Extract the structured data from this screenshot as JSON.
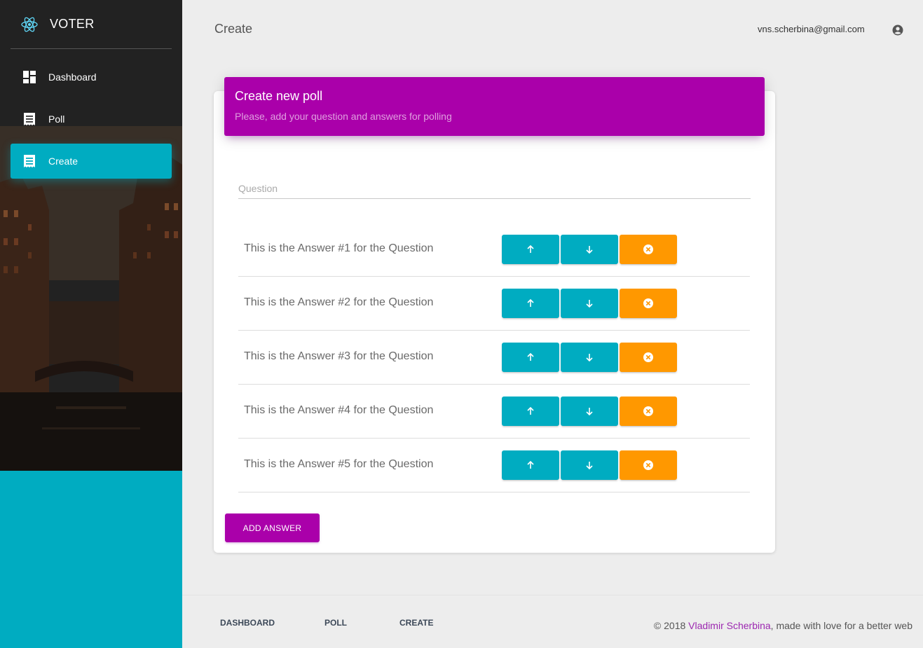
{
  "brand": {
    "name": "VOTER",
    "logo_icon": "react-atom-icon"
  },
  "sidebar": {
    "items": [
      {
        "label": "Dashboard",
        "icon": "dashboard-icon",
        "active": false
      },
      {
        "label": "Poll",
        "icon": "receipt-icon",
        "active": false
      },
      {
        "label": "Create",
        "icon": "receipt-icon",
        "active": true
      }
    ]
  },
  "header": {
    "title": "Create",
    "user_email": "vns.scherbina@gmail.com",
    "user_icon": "account-circle-icon"
  },
  "card": {
    "title": "Create new poll",
    "subtitle": "Please, add your question and answers for polling",
    "question_placeholder": "Question",
    "question_value": "",
    "answers": [
      "This is the Answer #1 for the Question",
      "This is the Answer #2 for the Question",
      "This is the Answer #3 for the Question",
      "This is the Answer #4 for the Question",
      "This is the Answer #5 for the Question"
    ],
    "add_button_label": "ADD ANSWER"
  },
  "footer": {
    "links": [
      "DASHBOARD",
      "POLL",
      "CREATE"
    ],
    "copyright_prefix": "© 2018 ",
    "author": "Vladimir Scherbina",
    "copyright_suffix": ", made with love for a better web"
  },
  "colors": {
    "accent_purple": "#aa00aa",
    "info_cyan": "#00acc1",
    "warning_orange": "#ff9800"
  }
}
